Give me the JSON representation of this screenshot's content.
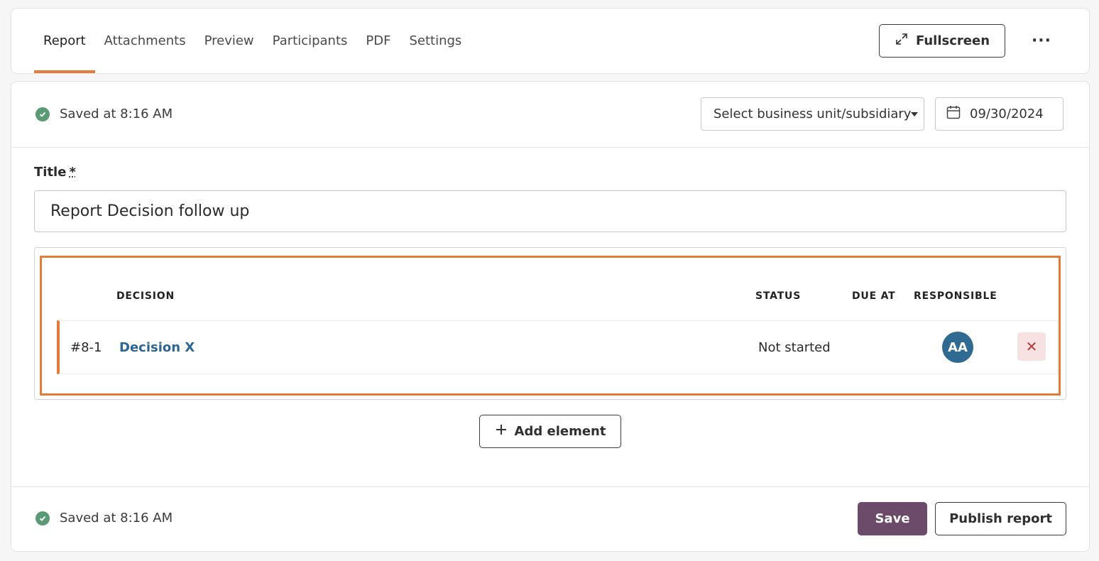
{
  "tabs": [
    {
      "label": "Report",
      "active": true
    },
    {
      "label": "Attachments"
    },
    {
      "label": "Preview"
    },
    {
      "label": "Participants"
    },
    {
      "label": "PDF"
    },
    {
      "label": "Settings"
    }
  ],
  "header": {
    "fullscreen_label": "Fullscreen",
    "more_label": "···"
  },
  "status": {
    "saved_text": "Saved at 8:16 AM"
  },
  "filters": {
    "business_unit_placeholder": "Select business unit/subsidiary",
    "date_value": "09/30/2024"
  },
  "form": {
    "title_label": "Title",
    "required_marker": "*",
    "title_value": "Report Decision follow up"
  },
  "table": {
    "columns": [
      "DECISION",
      "STATUS",
      "DUE AT",
      "RESPONSIBLE"
    ],
    "rows": [
      {
        "id": "#8-1",
        "decision": "Decision X",
        "status": "Not started",
        "due_at": "",
        "responsible_initials": "AA"
      }
    ],
    "remove_label": "✕"
  },
  "actions": {
    "add_element_label": "Add element",
    "save_label": "Save",
    "publish_label": "Publish report"
  },
  "colors": {
    "accent": "#e37b3a",
    "save_button": "#6b4a6a",
    "link": "#2d6593",
    "avatar": "#2f6a93",
    "saved_check": "#5a9a74"
  }
}
